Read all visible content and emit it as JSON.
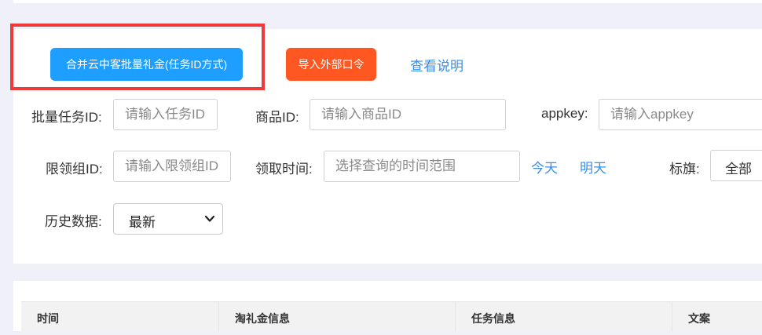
{
  "toolbar": {
    "merge_button_label": "合并云中客批量礼金(任务ID方式)",
    "import_button_label": "导入外部口令",
    "instructions_link": "查看说明"
  },
  "filters": {
    "batch_task_id": {
      "label": "批量任务ID:",
      "placeholder": "请输入任务ID"
    },
    "goods_id": {
      "label": "商品ID:",
      "placeholder": "请输入商品ID"
    },
    "appkey": {
      "label": "appkey:",
      "placeholder": "请输入appkey"
    },
    "limit_group_id": {
      "label": "限领组ID:",
      "placeholder": "请输入限领组ID"
    },
    "claim_time": {
      "label": "领取时间:",
      "placeholder": "选择查询的时间范围",
      "today": "今天",
      "tomorrow": "明天"
    },
    "flag": {
      "label": "标旗:",
      "value": "全部"
    },
    "history": {
      "label": "历史数据:",
      "value": "最新"
    }
  },
  "table": {
    "columns": [
      "时间",
      "淘礼金信息",
      "任务信息",
      "文案"
    ]
  },
  "colors": {
    "primary": "#1e9fff",
    "danger": "#ff5722",
    "link": "#3a8ee6",
    "highlight": "#ee3a3a"
  }
}
